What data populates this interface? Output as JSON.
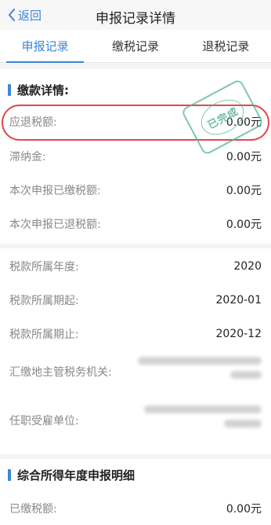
{
  "nav": {
    "back_label": "返回",
    "title": "申报记录详情"
  },
  "tabs": [
    {
      "label": "申报记录",
      "active": true
    },
    {
      "label": "缴税记录",
      "active": false
    },
    {
      "label": "退税记录",
      "active": false
    }
  ],
  "payment_details": {
    "section_title": "缴款详情:",
    "rows": [
      {
        "label": "应退税额:",
        "value": "0.00元"
      },
      {
        "label": "滞纳金:",
        "value": "0.00元"
      },
      {
        "label": "本次申报已缴税额:",
        "value": "0.00元"
      },
      {
        "label": "本次申报已退税额:",
        "value": "0.00元"
      }
    ],
    "stamp_text": "已完成"
  },
  "tax_info": {
    "rows": [
      {
        "label": "税款所属年度:",
        "value": "2020"
      },
      {
        "label": "税款所属期起:",
        "value": "2020-01"
      },
      {
        "label": "税款所属期止:",
        "value": "2020-12"
      },
      {
        "label": "汇缴地主管税务机关:",
        "value": ""
      },
      {
        "label": "任职受雇单位:",
        "value": ""
      }
    ]
  },
  "annual_details": {
    "section_title": "综合所得年度申报明细",
    "rows": [
      {
        "label": "已缴税额:",
        "value": "0.00元"
      }
    ]
  },
  "colors": {
    "accent": "#3b86d8",
    "highlight_oval": "#e0494f",
    "stamp": "#4fb793"
  }
}
